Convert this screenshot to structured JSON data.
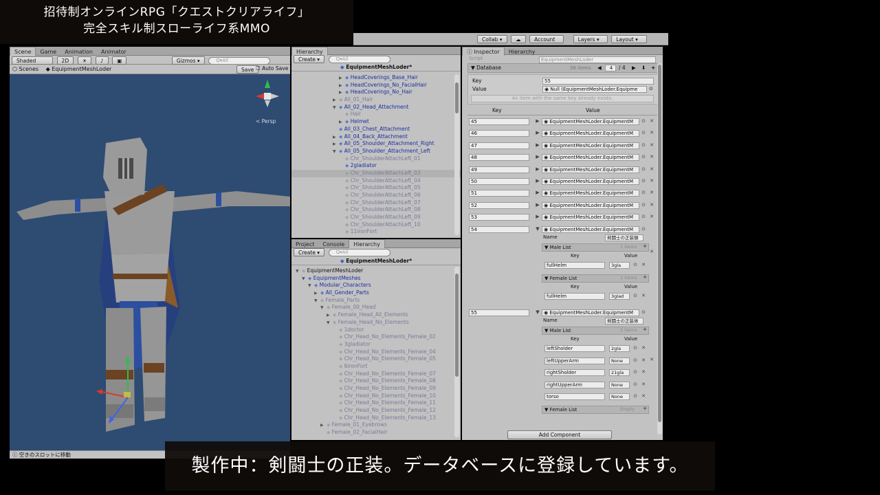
{
  "overlay": {
    "title_line1": "招待制オンラインRPG「クエストクリアライフ」",
    "title_line2": "完全スキル制スローライフ系MMO",
    "subtitle": "製作中：剣闘士の正装。データベースに登録しています。"
  },
  "toolbar": {
    "collab": "Collab ▾",
    "account": "Account ▾",
    "layers": "Layers ▾",
    "layout": "Layout ▾"
  },
  "scene": {
    "tabs": [
      "Scene",
      "Game",
      "Animation",
      "Animator"
    ],
    "shaded": "Shaded",
    "mode_2d": "2D",
    "gizmos": "Gizmos ▾",
    "search_placeholder": "Q▾All",
    "breadcrumb_scenes": "Scenes",
    "breadcrumb_obj": "EquipmentMeshLoder",
    "save": "Save",
    "auto_save": "Auto Save",
    "persp": "< Persp",
    "status": "空きのスロットに移動"
  },
  "hierarchy_top": {
    "tab": "Hierarchy",
    "create": "Create ▾",
    "search": "Q▾All",
    "title": "EquipmentMeshLoder*",
    "rows": [
      {
        "text": "HeadCoverings_Base_Hair",
        "indent": 7,
        "c": "blue",
        "a": "▶"
      },
      {
        "text": "HeadCoverings_No_FacialHair",
        "indent": 7,
        "c": "blue",
        "a": "▶"
      },
      {
        "text": "HeadCoverings_No_Hair",
        "indent": 7,
        "c": "blue",
        "a": "▶"
      },
      {
        "text": "All_01_Hair",
        "indent": 6,
        "c": "gray",
        "a": "▶"
      },
      {
        "text": "All_02_Head_Attachment",
        "indent": 6,
        "c": "blue",
        "a": "▼"
      },
      {
        "text": "Hair",
        "indent": 7,
        "c": "gray",
        "a": ""
      },
      {
        "text": "Helmet",
        "indent": 7,
        "c": "blue",
        "a": "▶"
      },
      {
        "text": "All_03_Chest_Attachment",
        "indent": 6,
        "c": "blue",
        "a": ""
      },
      {
        "text": "All_04_Back_Attachment",
        "indent": 6,
        "c": "blue",
        "a": "▶"
      },
      {
        "text": "All_05_Shoulder_Attachment_Right",
        "indent": 6,
        "c": "blue",
        "a": "▶"
      },
      {
        "text": "All_05_Shoulder_Attachment_Left",
        "indent": 6,
        "c": "blue",
        "a": "▼"
      },
      {
        "text": "Chr_ShoulderAttachLeft_01",
        "indent": 7,
        "c": "gray",
        "a": ""
      },
      {
        "text": "2gladiator",
        "indent": 7,
        "c": "blue",
        "a": ""
      },
      {
        "text": "Chr_ShoulderAttachLeft_03",
        "indent": 7,
        "c": "gray",
        "a": "",
        "sel": true
      },
      {
        "text": "Chr_ShoulderAttachLeft_04",
        "indent": 7,
        "c": "gray",
        "a": ""
      },
      {
        "text": "Chr_ShoulderAttachLeft_05",
        "indent": 7,
        "c": "gray",
        "a": ""
      },
      {
        "text": "Chr_ShoulderAttachLeft_06",
        "indent": 7,
        "c": "gray",
        "a": ""
      },
      {
        "text": "Chr_ShoulderAttachLeft_07",
        "indent": 7,
        "c": "gray",
        "a": ""
      },
      {
        "text": "Chr_ShoulderAttachLeft_08",
        "indent": 7,
        "c": "gray",
        "a": ""
      },
      {
        "text": "Chr_ShoulderAttachLeft_09",
        "indent": 7,
        "c": "gray",
        "a": ""
      },
      {
        "text": "Chr_ShoulderAttachLeft_10",
        "indent": 7,
        "c": "gray",
        "a": ""
      },
      {
        "text": "11ironFort",
        "indent": 7,
        "c": "gray",
        "a": ""
      }
    ]
  },
  "hierarchy_bottom": {
    "tabs": [
      "Project",
      "Console",
      "Hierarchy"
    ],
    "create": "Create ▾",
    "search": "Q▾All",
    "title": "EquipmentMeshLoder*",
    "rows": [
      {
        "text": "EquipmentMeshLoder",
        "indent": 0,
        "c": "black",
        "a": "▼"
      },
      {
        "text": "EquipmentMeshes",
        "indent": 1,
        "c": "blue",
        "a": "▼"
      },
      {
        "text": "Modular_Characters",
        "indent": 2,
        "c": "blue",
        "a": "▼"
      },
      {
        "text": "All_Gender_Parts",
        "indent": 3,
        "c": "blue",
        "a": "▶"
      },
      {
        "text": "Female_Parts",
        "indent": 3,
        "c": "gray",
        "a": "▼"
      },
      {
        "text": "Female_00_Head",
        "indent": 4,
        "c": "gray",
        "a": "▼"
      },
      {
        "text": "Female_Head_All_Elements",
        "indent": 5,
        "c": "gray",
        "a": "▶"
      },
      {
        "text": "Female_Head_No_Elements",
        "indent": 5,
        "c": "gray",
        "a": "▼"
      },
      {
        "text": "1doctor",
        "indent": 6,
        "c": "gray",
        "a": ""
      },
      {
        "text": "Chr_Head_No_Elements_Female_02",
        "indent": 6,
        "c": "gray",
        "a": ""
      },
      {
        "text": "3gladiator",
        "indent": 6,
        "c": "gray",
        "a": ""
      },
      {
        "text": "Chr_Head_No_Elements_Female_04",
        "indent": 6,
        "c": "gray",
        "a": ""
      },
      {
        "text": "Chr_Head_No_Elements_Female_05",
        "indent": 6,
        "c": "gray",
        "a": ""
      },
      {
        "text": "6ironFort",
        "indent": 6,
        "c": "gray",
        "a": ""
      },
      {
        "text": "Chr_Head_No_Elements_Female_07",
        "indent": 6,
        "c": "gray",
        "a": ""
      },
      {
        "text": "Chr_Head_No_Elements_Female_08",
        "indent": 6,
        "c": "gray",
        "a": ""
      },
      {
        "text": "Chr_Head_No_Elements_Female_09",
        "indent": 6,
        "c": "gray",
        "a": ""
      },
      {
        "text": "Chr_Head_No_Elements_Female_10",
        "indent": 6,
        "c": "gray",
        "a": ""
      },
      {
        "text": "Chr_Head_No_Elements_Female_11",
        "indent": 6,
        "c": "gray",
        "a": ""
      },
      {
        "text": "Chr_Head_No_Elements_Female_12",
        "indent": 6,
        "c": "gray",
        "a": ""
      },
      {
        "text": "Chr_Head_No_Elements_Female_13",
        "indent": 6,
        "c": "gray",
        "a": ""
      },
      {
        "text": "Female_01_Eyebrows",
        "indent": 4,
        "c": "gray",
        "a": "▶"
      },
      {
        "text": "Female_02_FacialHair",
        "indent": 4,
        "c": "gray",
        "a": ""
      }
    ]
  },
  "inspector": {
    "tabs": [
      "Inspector",
      "Hierarchy"
    ],
    "script_label": "Script",
    "script_value": "EquipmentMeshLoder",
    "database_label": "Database",
    "items_count": "56 items",
    "page": "4",
    "page_total": "/ 4",
    "key_label": "Key",
    "key_value": "55",
    "value_label": "Value",
    "value_value": "Null (EquipmentMeshLoder.Equipme",
    "warning": "An item with the same key already exists.",
    "col_key": "Key",
    "col_value": "Value",
    "entry_value": "EquipmentMeshLoder.EquipmentM",
    "keys": [
      "45",
      "46",
      "47",
      "48",
      "49",
      "50",
      "51",
      "52",
      "53"
    ],
    "expanded": [
      {
        "key": "54",
        "name_label": "Name",
        "name_value": "剣闘士の正装頭",
        "lists": [
          {
            "label": "Male List",
            "count": "1 items",
            "rows": [
              {
                "k": "fullHelm",
                "v": "3gla"
              }
            ]
          },
          {
            "label": "Female List",
            "count": "1 items",
            "rows": [
              {
                "k": "fullHelm",
                "v": "3glad"
              }
            ]
          }
        ]
      },
      {
        "key": "55",
        "name_label": "Name",
        "name_value": "剣闘士の正装体",
        "lists": [
          {
            "label": "Male List",
            "count": "5 items",
            "rows": [
              {
                "k": "leftSholder",
                "v": "2gla"
              },
              {
                "k": "leftUpperArm",
                "v": "None"
              },
              {
                "k": "rightSholder",
                "v": "21gla"
              },
              {
                "k": "rightUpperArm",
                "v": "None"
              },
              {
                "k": "torso",
                "v": "None"
              }
            ]
          },
          {
            "label": "Female List",
            "count": "Empty",
            "rows": []
          }
        ]
      }
    ],
    "add_component": "Add Component"
  },
  "colors": {
    "scene_bg": "#2e4b72",
    "editor_bg": "#c2c2c2",
    "hierarchy_blue": "#1b2fa0"
  }
}
